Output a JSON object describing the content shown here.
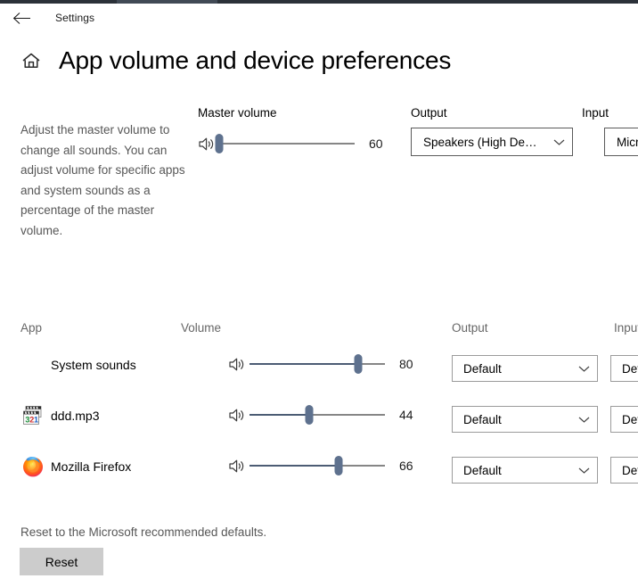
{
  "titlebar": {
    "back_icon": "back-arrow-icon",
    "app_title": "Settings"
  },
  "header": {
    "home_icon": "home-icon",
    "page_title": "App volume and device preferences"
  },
  "master": {
    "description": "Adjust the master volume to change all sounds. You can adjust volume for specific apps and system sounds as a percentage of the master volume.",
    "volume_label": "Master volume",
    "output_label": "Output",
    "input_label": "Input",
    "volume_value": 60,
    "volume_value_text": "60",
    "speaker_icon": "speaker-volume-icon",
    "output_device": "Speakers (High De…",
    "input_device": "Microph",
    "chevron_icon": "chevron-down-icon"
  },
  "app_list": {
    "headers": {
      "app": "App",
      "volume": "Volume",
      "output": "Output",
      "input": "Input"
    },
    "rows": [
      {
        "icon": "none",
        "name": "System sounds",
        "volume": 80,
        "volume_text": "80",
        "speaker_icon": "speaker-volume-icon",
        "output": "Default",
        "input": "Def"
      },
      {
        "icon": "media-player-classic-icon",
        "name": "ddd.mp3",
        "volume": 44,
        "volume_text": "44",
        "speaker_icon": "speaker-volume-icon",
        "output": "Default",
        "input": "Def"
      },
      {
        "icon": "firefox-icon",
        "name": "Mozilla Firefox",
        "volume": 66,
        "volume_text": "66",
        "speaker_icon": "speaker-volume-icon",
        "output": "Default",
        "input": "Def"
      }
    ]
  },
  "reset": {
    "text": "Reset to the Microsoft recommended defaults.",
    "button_label": "Reset"
  },
  "colors": {
    "slider_fill": "#4c5c74",
    "slider_thumb": "#5e718e",
    "slider_track": "#868686",
    "muted_text": "#575757",
    "button_bg": "#cccccc",
    "top_strip": "#2b3139"
  }
}
